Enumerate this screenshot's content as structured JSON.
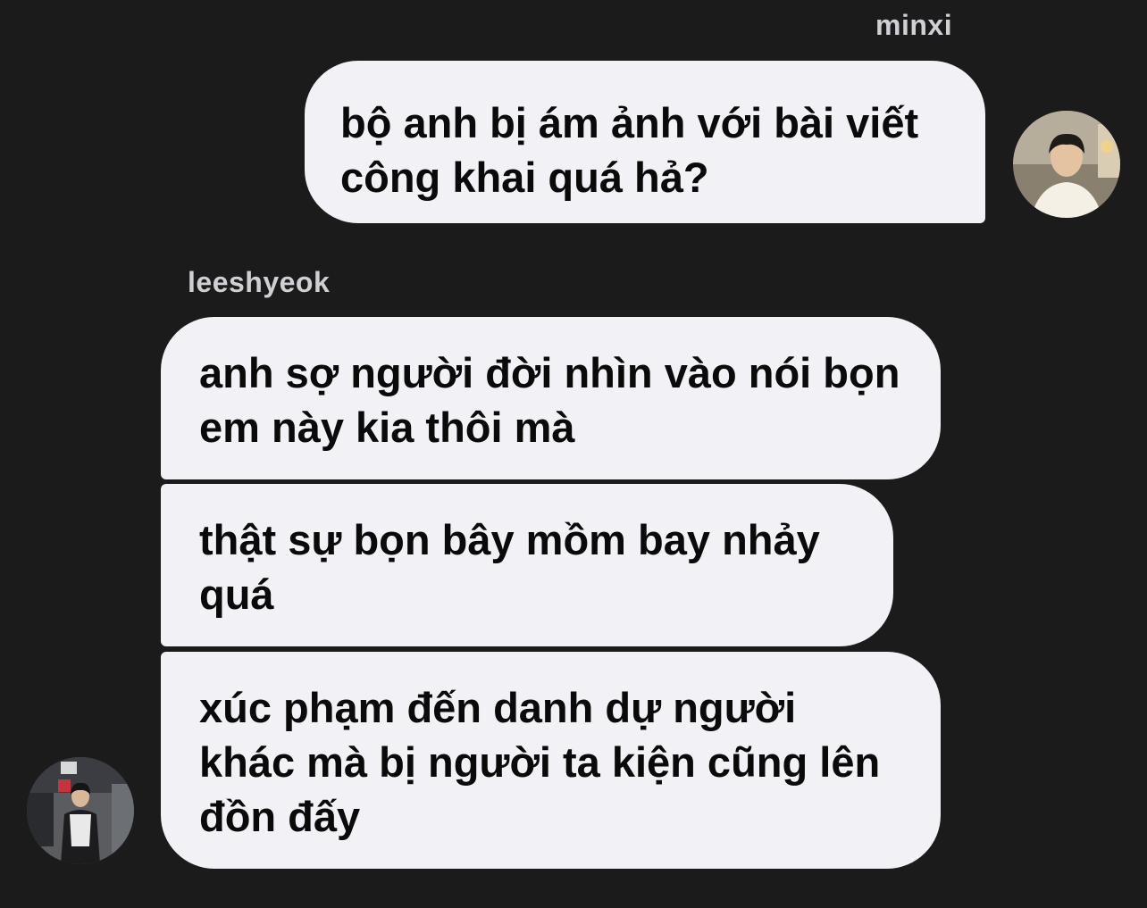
{
  "conversation": {
    "outgoing": {
      "sender": "minxi",
      "avatar_icon": "user-avatar-photo-icon",
      "messages": [
        {
          "text": "bộ anh bị ám ảnh với bài viết\ncông khai quá hả?"
        }
      ]
    },
    "incoming": {
      "sender": "leeshyeok",
      "avatar_icon": "user-avatar-photo-icon",
      "messages": [
        {
          "text": "anh sợ người đời nhìn vào nói bọn\nem này kia thôi mà"
        },
        {
          "text": "thật sự bọn bây mồm bay nhảy\nquá"
        },
        {
          "text": "xúc phạm đến danh dự người\nkhác mà bị người ta kiện cũng lên\nđồn đấy"
        }
      ]
    }
  },
  "colors": {
    "background": "#1b1b1b",
    "bubble": "#f1f1f6",
    "bubble_text": "#0a0a0a",
    "sender_name": "#cfcfd4"
  }
}
